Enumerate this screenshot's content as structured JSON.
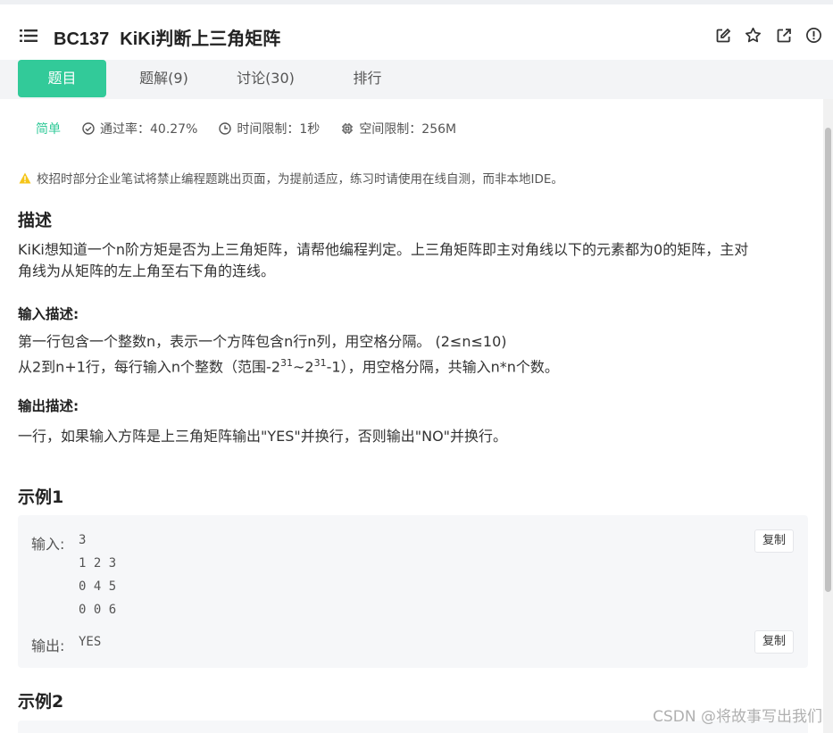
{
  "header": {
    "problem_id": "BC137",
    "problem_title": "KiKi判断上三角矩阵",
    "actions": [
      "edit-icon",
      "star-icon",
      "external-link-icon",
      "info-icon"
    ]
  },
  "tabs": [
    {
      "label": "题目",
      "active": true
    },
    {
      "label": "题解(9)",
      "active": false
    },
    {
      "label": "讨论(30)",
      "active": false
    },
    {
      "label": "排行",
      "active": false
    }
  ],
  "meta": {
    "difficulty": "简单",
    "pass_rate": "通过率：40.27%",
    "time_limit": "时间限制：1秒",
    "space_limit": "空间限制：256M"
  },
  "notice": "校招时部分企业笔试将禁止编程题跳出页面，为提前适应，练习时请使用在线自测，而非本地IDE。",
  "description": {
    "heading": "描述",
    "line1": "KiKi想知道一个n阶方矩是否为上三角矩阵，请帮他编程判定。上三角矩阵即主对角线以下的元素都为0的矩阵，主对",
    "line2": "角线为从矩阵的左上角至右下角的连线。"
  },
  "input_desc": {
    "heading": "输入描述:",
    "line1": "第一行包含一个整数n，表示一个方阵包含n行n列，用空格分隔。 (2≤n≤10)",
    "line2_a": "从2到n+1行，每行输入n个整数（范围-2",
    "line2_exp1": "31",
    "line2_b": "~2",
    "line2_exp2": "31",
    "line2_c": "-1），用空格分隔，共输入n*n个数。"
  },
  "output_desc": {
    "heading": "输出描述:",
    "line1": "一行，如果输入方阵是上三角矩阵输出\"YES\"并换行，否则输出\"NO\"并换行。"
  },
  "example1": {
    "heading": "示例1",
    "input_label": "输入:",
    "input_lines": "3\n1 2 3\n0 4 5\n0 0 6",
    "output_label": "输出:",
    "output": "YES",
    "copy_label": "复制"
  },
  "example2": {
    "heading": "示例2"
  },
  "watermark": "CSDN @将故事写出我们",
  "colors": {
    "accent": "#32ca99",
    "warning": "#f5c518"
  }
}
